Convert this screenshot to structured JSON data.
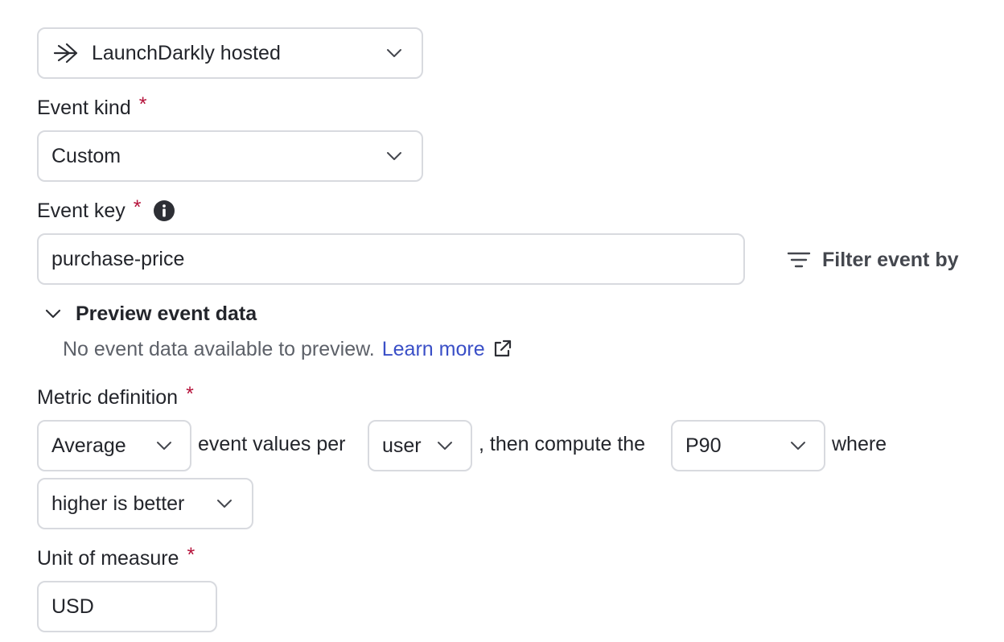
{
  "source_select": {
    "value": "LaunchDarkly hosted",
    "icon": "launchdarkly-logo-icon"
  },
  "event_kind": {
    "label": "Event kind",
    "required_mark": "*",
    "value": "Custom"
  },
  "event_key": {
    "label": "Event key",
    "required_mark": "*",
    "info_icon": "info-icon",
    "value": "purchase-price"
  },
  "filter": {
    "label": "Filter event by",
    "icon": "filter-icon"
  },
  "preview": {
    "toggle_label": "Preview event data",
    "empty_text": "No event data available to preview.",
    "learn_more": "Learn more",
    "external_icon": "external-link-icon"
  },
  "metric_definition": {
    "label": "Metric definition",
    "required_mark": "*",
    "aggregation": "Average",
    "text_1": "event values per",
    "unit": "user",
    "text_2": ", then compute the",
    "statistic": "P90",
    "text_3": "where",
    "direction": "higher is better"
  },
  "unit_of_measure": {
    "label": "Unit of measure",
    "required_mark": "*",
    "value": "USD"
  },
  "colors": {
    "required": "#b5123a",
    "link": "#3a4fc7",
    "border": "#d8dadf",
    "text": "#23252b"
  }
}
